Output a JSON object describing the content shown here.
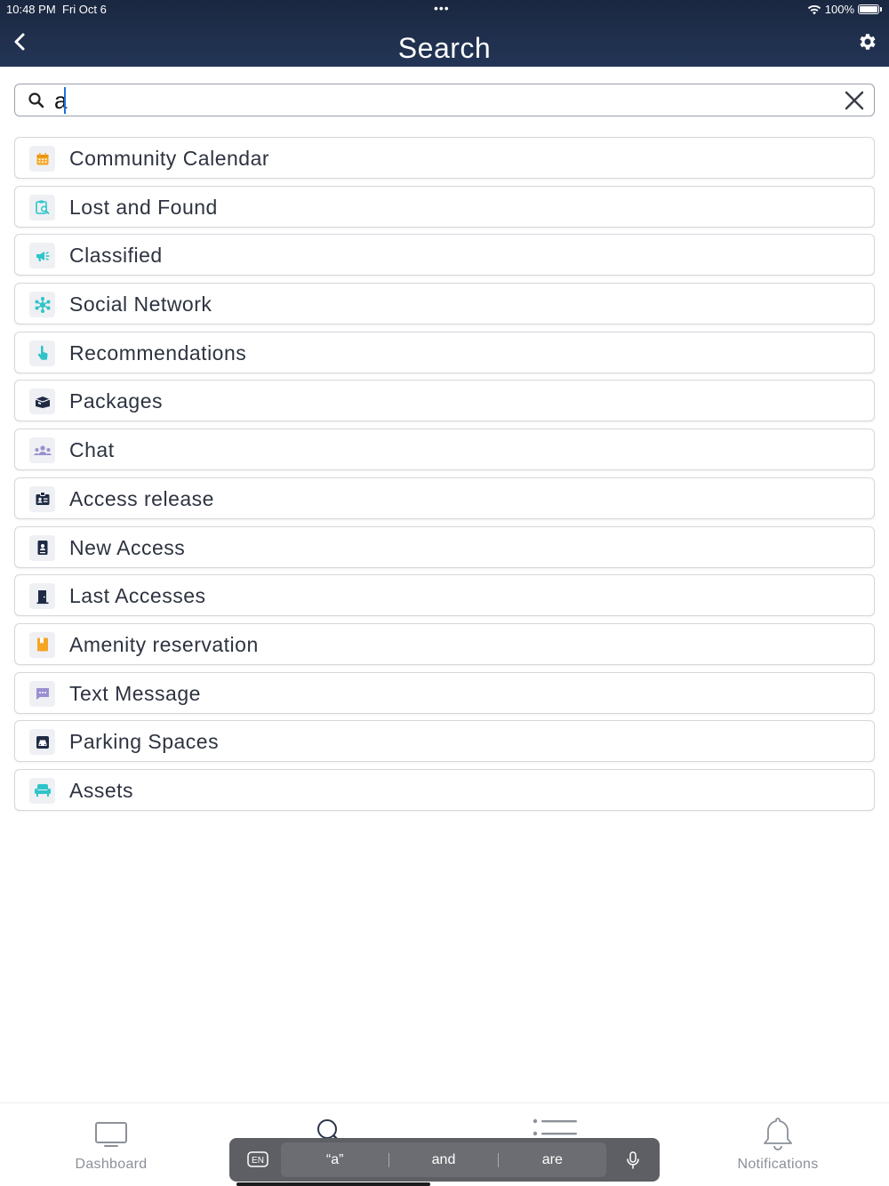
{
  "status_bar": {
    "time": "10:48 PM",
    "date": "Fri Oct 6",
    "dots": "•••",
    "battery": "100%"
  },
  "header": {
    "title": "Search"
  },
  "search": {
    "value": "a"
  },
  "results": [
    {
      "label": "Community Calendar",
      "icon": "calendar-icon",
      "color": "#f5a623"
    },
    {
      "label": "Lost and Found",
      "icon": "lost-found-icon",
      "color": "#2ec4c9"
    },
    {
      "label": "Classified",
      "icon": "megaphone-icon",
      "color": "#2ec4c9"
    },
    {
      "label": "Social Network",
      "icon": "network-icon",
      "color": "#2ec4c9"
    },
    {
      "label": "Recommendations",
      "icon": "hand-pointer-icon",
      "color": "#2ec4c9"
    },
    {
      "label": "Packages",
      "icon": "package-icon",
      "color": "#1f2a44"
    },
    {
      "label": "Chat",
      "icon": "users-icon",
      "color": "#9a8fd1"
    },
    {
      "label": "Access release",
      "icon": "id-badge-icon",
      "color": "#1f2a44"
    },
    {
      "label": "New Access",
      "icon": "id-card-icon",
      "color": "#1f2a44"
    },
    {
      "label": "Last Accesses",
      "icon": "door-icon",
      "color": "#1f2a44"
    },
    {
      "label": "Amenity reservation",
      "icon": "bookmark-icon",
      "color": "#f5a623"
    },
    {
      "label": "Text Message",
      "icon": "message-icon",
      "color": "#9a8fd1"
    },
    {
      "label": "Parking Spaces",
      "icon": "car-icon",
      "color": "#1f2a44"
    },
    {
      "label": "Assets",
      "icon": "armchair-icon",
      "color": "#2ec4c9"
    }
  ],
  "tabbar": {
    "dashboard": "Dashboard",
    "notifications": "Notifications"
  },
  "keyboard": {
    "lang": "EN",
    "suggestions": [
      "“a”",
      "and",
      "are"
    ]
  }
}
